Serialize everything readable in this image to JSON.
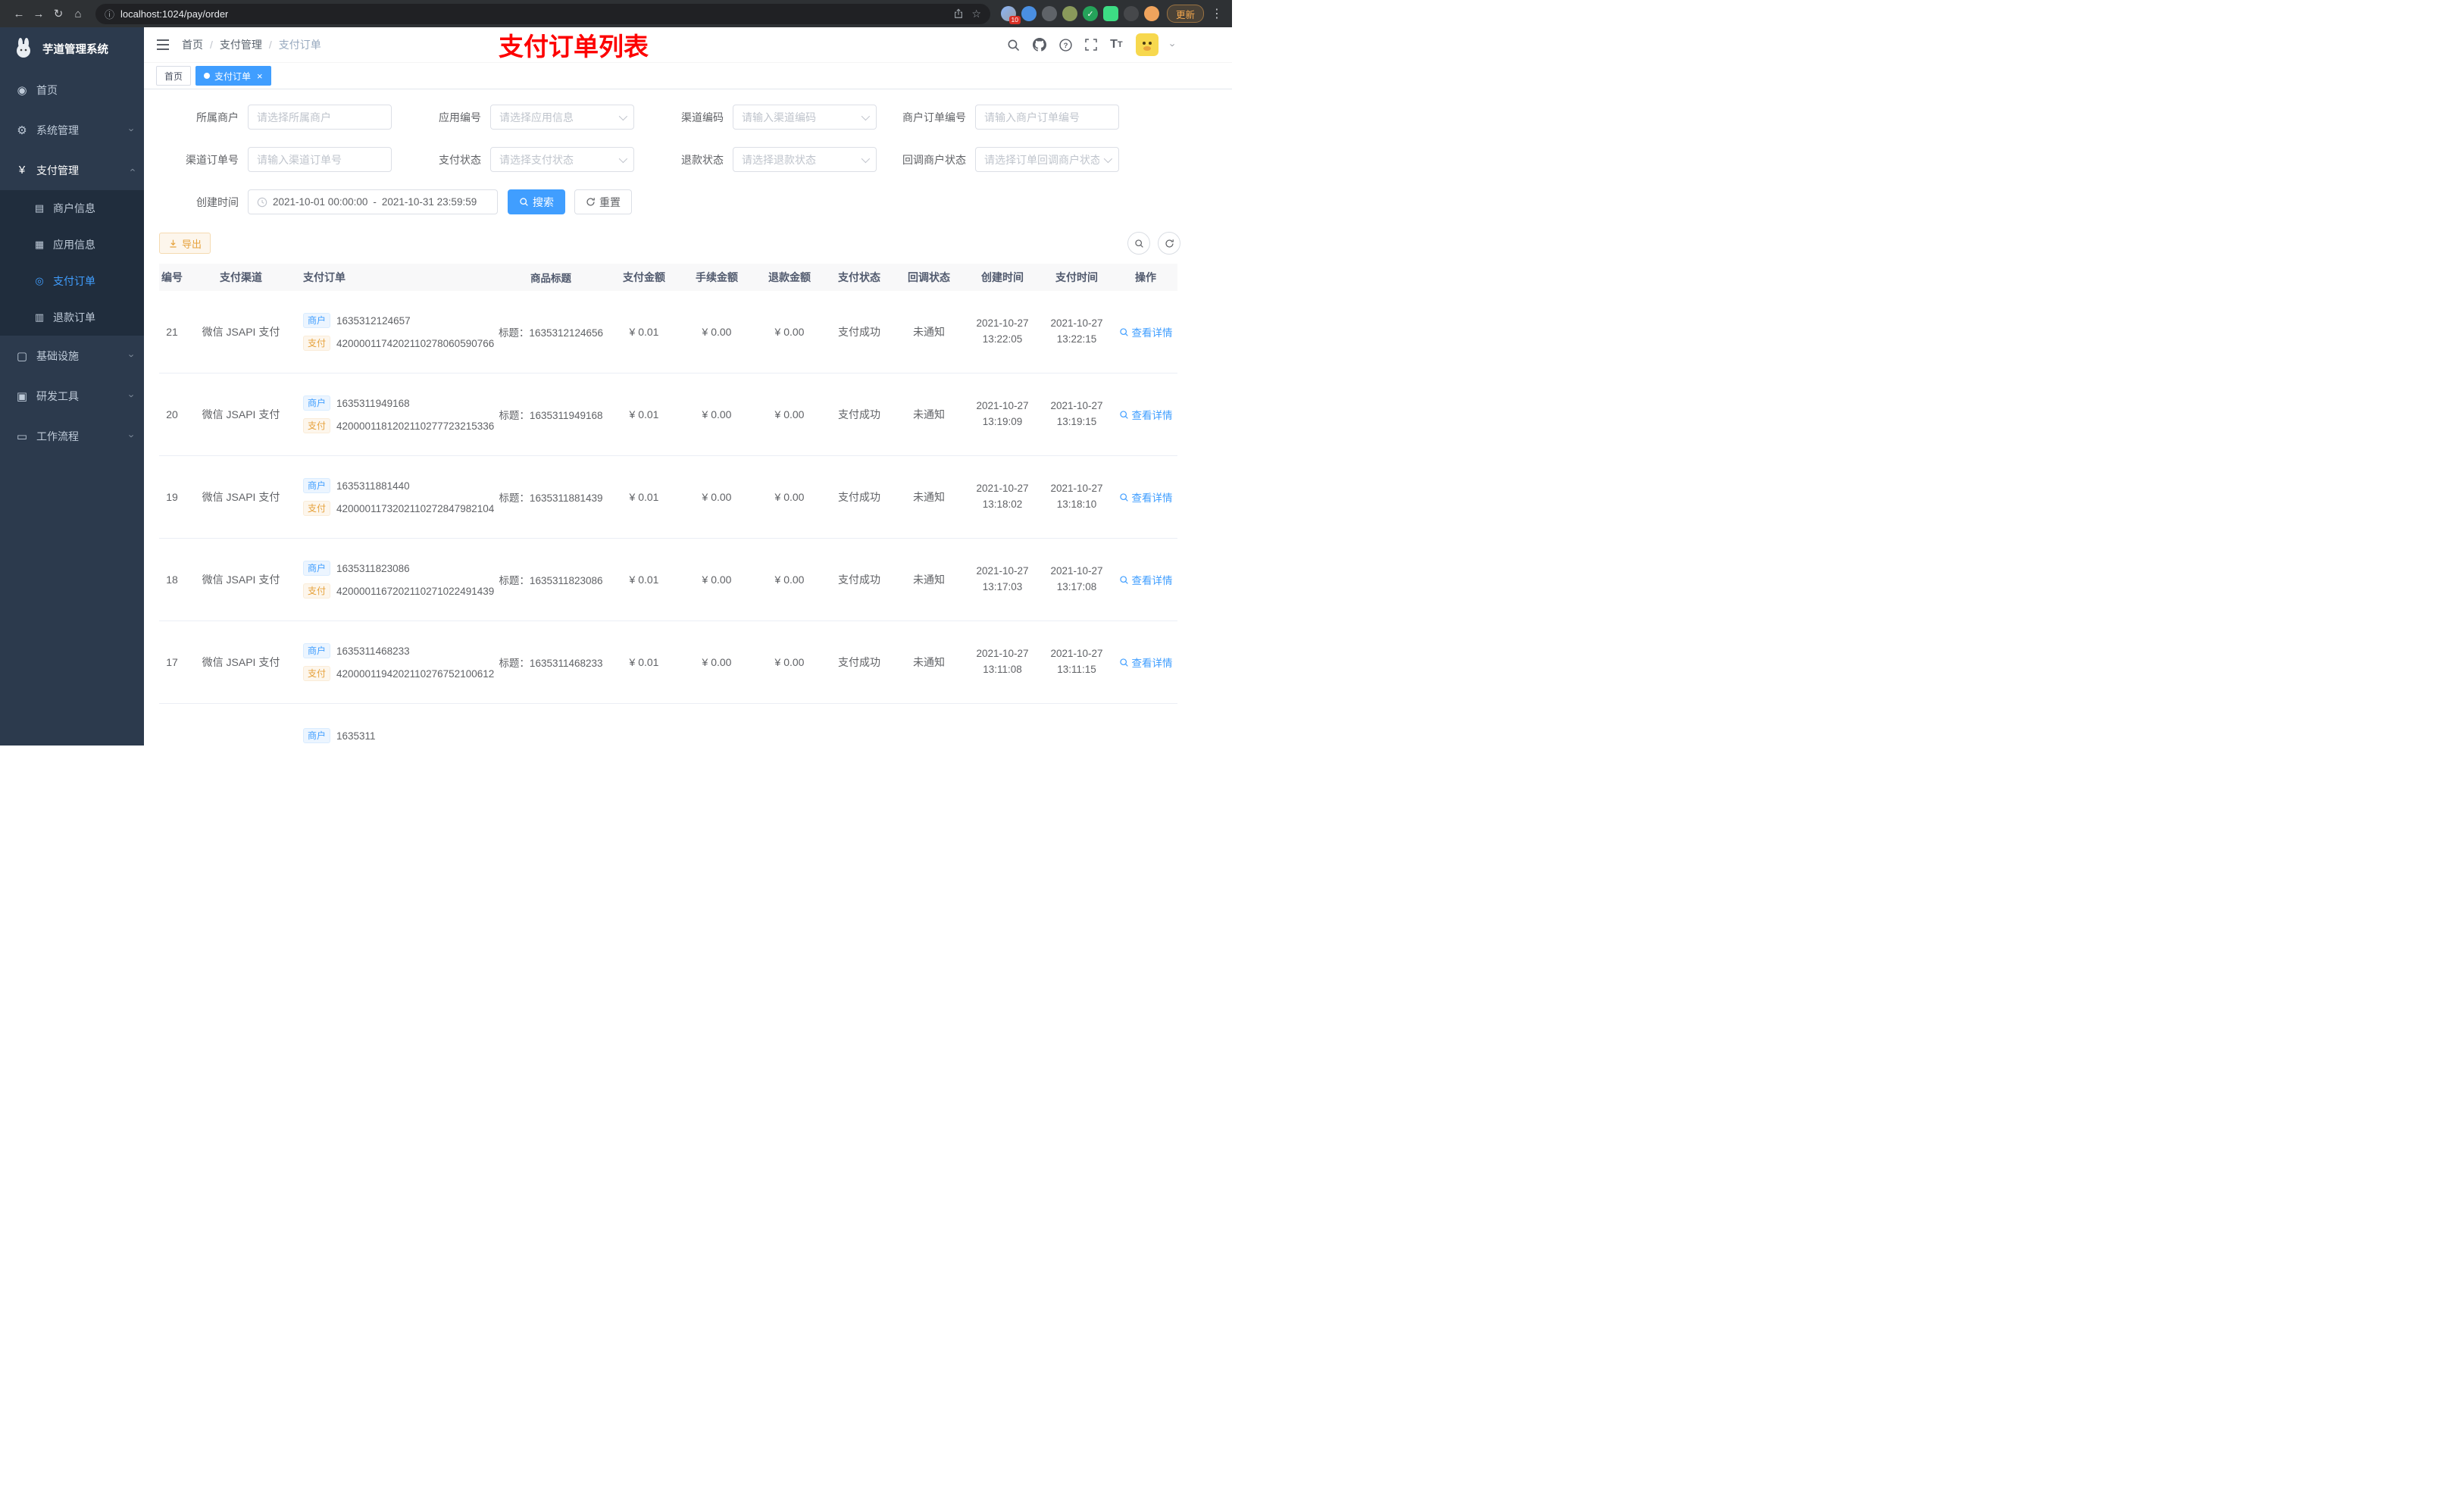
{
  "browser": {
    "url": "localhost:1024/pay/order",
    "update_label": "更新",
    "extension_badge": "10"
  },
  "sidebar": {
    "title": "芋道管理系统",
    "menu": {
      "home": "首页",
      "system": "系统管理",
      "payment": "支付管理",
      "merchant": "商户信息",
      "app": "应用信息",
      "order": "支付订单",
      "refund": "退款订单",
      "infra": "基础设施",
      "devtools": "研发工具",
      "workflow": "工作流程"
    }
  },
  "header": {
    "breadcrumb": [
      "首页",
      "支付管理",
      "支付订单"
    ],
    "overlay_title": "支付订单列表"
  },
  "tabs": {
    "home": "首页",
    "active": "支付订单"
  },
  "filters": {
    "fields": [
      {
        "label": "所属商户",
        "placeholder": "请选择所属商户"
      },
      {
        "label": "应用编号",
        "placeholder": "请选择应用信息"
      },
      {
        "label": "渠道编码",
        "placeholder": "请输入渠道编码"
      },
      {
        "label": "商户订单编号",
        "placeholder": "请输入商户订单编号"
      },
      {
        "label": "渠道订单号",
        "placeholder": "请输入渠道订单号"
      },
      {
        "label": "支付状态",
        "placeholder": "请选择支付状态"
      },
      {
        "label": "退款状态",
        "placeholder": "请选择退款状态"
      },
      {
        "label": "回调商户状态",
        "placeholder": "请选择订单回调商户状态"
      }
    ],
    "date_label": "创建时间",
    "date_start": "2021-10-01 00:00:00",
    "date_separator": "-",
    "date_end": "2021-10-31 23:59:59",
    "search_label": "搜索",
    "reset_label": "重置"
  },
  "toolbar": {
    "export_label": "导出"
  },
  "table": {
    "columns": [
      "编号",
      "支付渠道",
      "支付订单",
      "商品标题",
      "支付金额",
      "手续金额",
      "退款金额",
      "支付状态",
      "回调状态",
      "创建时间",
      "支付时间",
      "操作"
    ],
    "rows": [
      {
        "id": "21",
        "channel": "微信 JSAPI 支付",
        "merchant_tag": "商户",
        "merchant_no": "1635312124657",
        "pay_tag": "支付",
        "pay_no": "4200001174202110278060590766",
        "title": "标题：1635312124656",
        "pay_amount": "¥ 0.01",
        "fee_amount": "¥ 0.00",
        "refund_amount": "¥ 0.00",
        "pay_status": "支付成功",
        "notify_status": "未通知",
        "create_date": "2021-10-27",
        "create_time": "13:22:05",
        "pay_date": "2021-10-27",
        "pay_time": "13:22:15",
        "action": "查看详情"
      },
      {
        "id": "20",
        "channel": "微信 JSAPI 支付",
        "merchant_tag": "商户",
        "merchant_no": "1635311949168",
        "pay_tag": "支付",
        "pay_no": "4200001181202110277723215336",
        "title": "标题：1635311949168",
        "pay_amount": "¥ 0.01",
        "fee_amount": "¥ 0.00",
        "refund_amount": "¥ 0.00",
        "pay_status": "支付成功",
        "notify_status": "未通知",
        "create_date": "2021-10-27",
        "create_time": "13:19:09",
        "pay_date": "2021-10-27",
        "pay_time": "13:19:15",
        "action": "查看详情"
      },
      {
        "id": "19",
        "channel": "微信 JSAPI 支付",
        "merchant_tag": "商户",
        "merchant_no": "1635311881440",
        "pay_tag": "支付",
        "pay_no": "4200001173202110272847982104",
        "title": "标题：1635311881439",
        "pay_amount": "¥ 0.01",
        "fee_amount": "¥ 0.00",
        "refund_amount": "¥ 0.00",
        "pay_status": "支付成功",
        "notify_status": "未通知",
        "create_date": "2021-10-27",
        "create_time": "13:18:02",
        "pay_date": "2021-10-27",
        "pay_time": "13:18:10",
        "action": "查看详情"
      },
      {
        "id": "18",
        "channel": "微信 JSAPI 支付",
        "merchant_tag": "商户",
        "merchant_no": "1635311823086",
        "pay_tag": "支付",
        "pay_no": "4200001167202110271022491439",
        "title": "标题：1635311823086",
        "pay_amount": "¥ 0.01",
        "fee_amount": "¥ 0.00",
        "refund_amount": "¥ 0.00",
        "pay_status": "支付成功",
        "notify_status": "未通知",
        "create_date": "2021-10-27",
        "create_time": "13:17:03",
        "pay_date": "2021-10-27",
        "pay_time": "13:17:08",
        "action": "查看详情"
      },
      {
        "id": "17",
        "channel": "微信 JSAPI 支付",
        "merchant_tag": "商户",
        "merchant_no": "1635311468233",
        "pay_tag": "支付",
        "pay_no": "4200001194202110276752100612",
        "title": "标题：1635311468233",
        "pay_amount": "¥ 0.01",
        "fee_amount": "¥ 0.00",
        "refund_amount": "¥ 0.00",
        "pay_status": "支付成功",
        "notify_status": "未通知",
        "create_date": "2021-10-27",
        "create_time": "13:11:08",
        "pay_date": "2021-10-27",
        "pay_time": "13:11:15",
        "action": "查看详情"
      }
    ],
    "partial_row": {
      "merchant_tag": "商户",
      "merchant_no": "1635311"
    }
  },
  "colors": {
    "accent": "#409eff",
    "warning": "#e6a23c",
    "annotation_red": "#fd0000"
  }
}
